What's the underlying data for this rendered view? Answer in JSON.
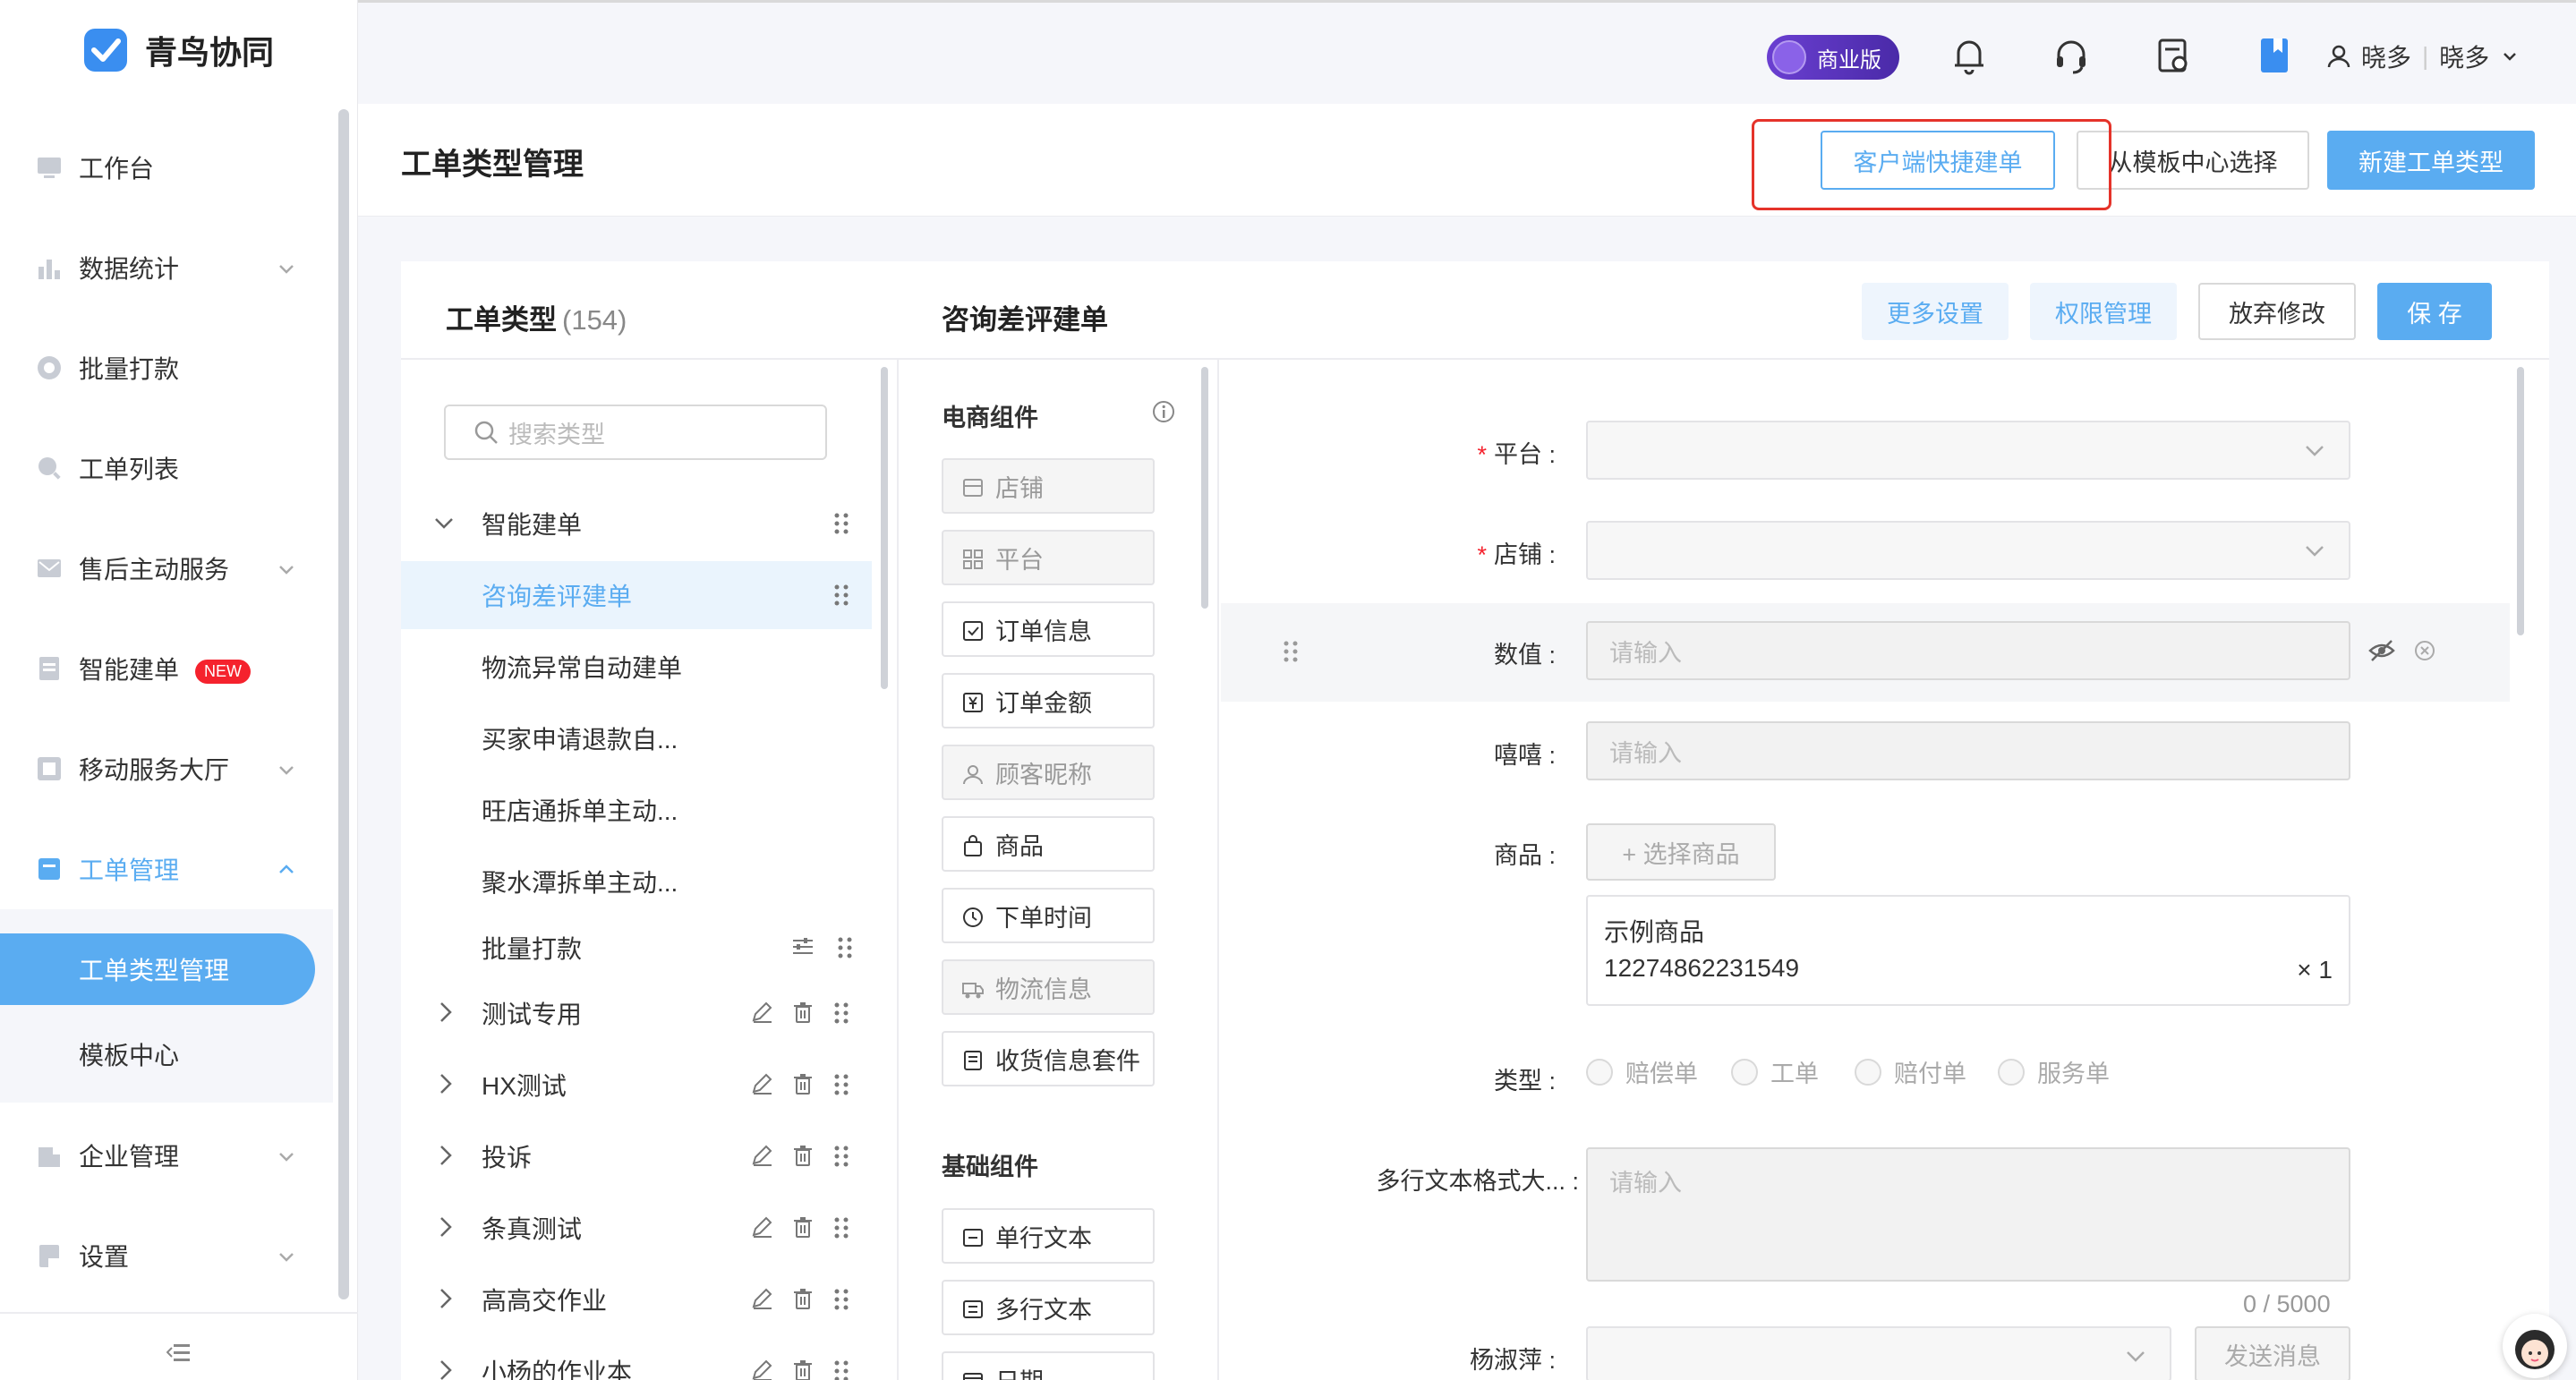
{
  "app": {
    "name": "青鸟协同"
  },
  "sidebar": {
    "items": [
      {
        "label": "工作台",
        "icon": "desktop-icon"
      },
      {
        "label": "数据统计",
        "icon": "bar-chart-icon"
      },
      {
        "label": "批量打款",
        "icon": "coin-icon"
      },
      {
        "label": "工单列表",
        "icon": "search-list-icon"
      },
      {
        "label": "售后主动服务",
        "icon": "mail-icon"
      },
      {
        "label": "智能建单",
        "icon": "doc-icon",
        "badge": "NEW"
      },
      {
        "label": "移动服务大厅",
        "icon": "grid-icon"
      },
      {
        "label": "工单管理",
        "icon": "ticket-icon"
      },
      {
        "label": "企业管理",
        "icon": "building-icon"
      },
      {
        "label": "设置",
        "icon": "settings-icon"
      }
    ],
    "sub_items": [
      {
        "label": "工单类型管理"
      },
      {
        "label": "模板中心"
      }
    ],
    "collapse_icon": "collapse-icon"
  },
  "topbar": {
    "badge": "商业版",
    "user": "晓多",
    "org": "晓多"
  },
  "header": {
    "title": "工单类型管理",
    "btn_quick": "客户端快捷建单",
    "btn_template": "从模板中心选择",
    "btn_new": "新建工单类型"
  },
  "types_panel": {
    "title": "工单类型",
    "count": "(154)",
    "search_placeholder": "搜索类型",
    "tree": [
      {
        "label": "智能建单",
        "kind": "group-open"
      },
      {
        "label": "咨询差评建单",
        "kind": "child",
        "selected": true
      },
      {
        "label": "物流异常自动建单",
        "kind": "child"
      },
      {
        "label": "买家申请退款自...",
        "kind": "child"
      },
      {
        "label": "旺店通拆单主动...",
        "kind": "child"
      },
      {
        "label": "聚水潭拆单主动...",
        "kind": "child"
      },
      {
        "label": "批量打款",
        "kind": "child-settings"
      },
      {
        "label": "测试专用",
        "kind": "group"
      },
      {
        "label": "HX测试",
        "kind": "group"
      },
      {
        "label": "投诉",
        "kind": "group"
      },
      {
        "label": "条真测试",
        "kind": "group"
      },
      {
        "label": "高高交作业",
        "kind": "group"
      },
      {
        "label": "小杨的作业本",
        "kind": "group"
      }
    ]
  },
  "form_header": {
    "title": "咨询差评建单",
    "btn_more": "更多设置",
    "btn_perm": "权限管理",
    "btn_discard": "放弃修改",
    "btn_save": "保 存"
  },
  "components": {
    "ecommerce_title": "电商组件",
    "ecommerce": [
      {
        "label": "店铺",
        "disabled": true
      },
      {
        "label": "平台",
        "disabled": true
      },
      {
        "label": "订单信息",
        "disabled": false
      },
      {
        "label": "订单金额",
        "disabled": false
      },
      {
        "label": "顾客昵称",
        "disabled": true
      },
      {
        "label": "商品",
        "disabled": false
      },
      {
        "label": "下单时间",
        "disabled": false
      },
      {
        "label": "物流信息",
        "disabled": true
      },
      {
        "label": "收货信息套件",
        "disabled": false
      }
    ],
    "basic_title": "基础组件",
    "basic": [
      {
        "label": "单行文本",
        "disabled": false
      },
      {
        "label": "多行文本",
        "disabled": false
      },
      {
        "label": "日期",
        "disabled": false
      }
    ]
  },
  "form": {
    "platform_label": "平台 :",
    "shop_label": "店铺 :",
    "number_label": "数值 :",
    "number_placeholder": "请输入",
    "xixi_label": "嘻嘻 :",
    "xixi_placeholder": "请输入",
    "goods_label": "商品 :",
    "goods_btn": "+ 选择商品",
    "goods_name": "示例商品",
    "goods_id": "12274862231549",
    "goods_qty": "× 1",
    "type_label": "类型 :",
    "type_options": [
      "赔偿单",
      "工单",
      "赔付单",
      "服务单"
    ],
    "multiline_label": "多行文本格式大... :",
    "multiline_placeholder": "请输入",
    "multiline_count": "0 / 5000",
    "yang_label": "杨淑萍 :",
    "send_btn": "发送消息"
  }
}
